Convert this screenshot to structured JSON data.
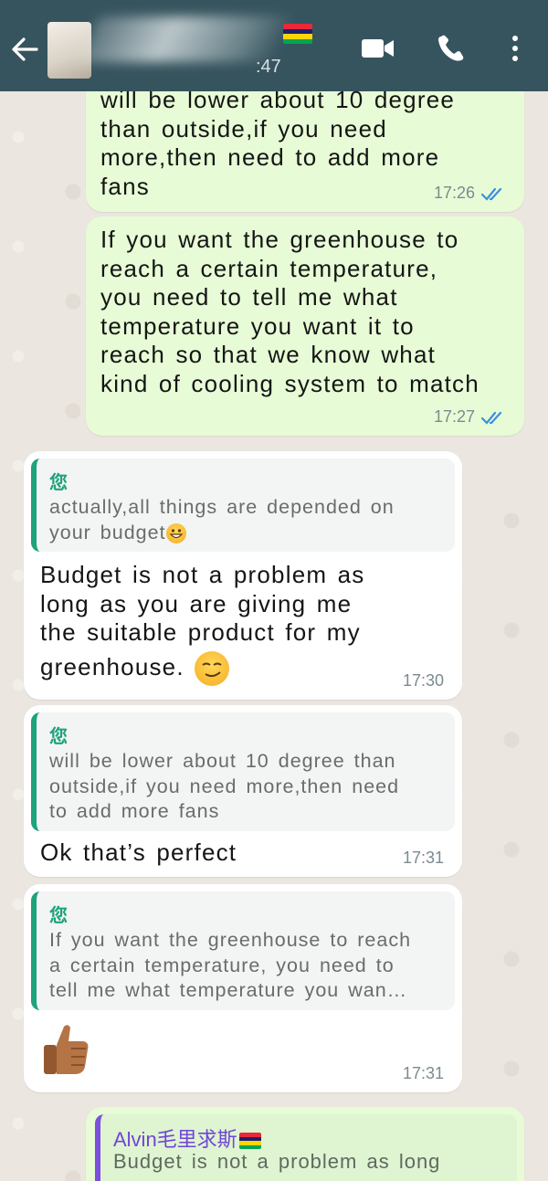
{
  "header": {
    "back_icon": "back-arrow-icon",
    "last_seen": ":47",
    "flag_colors": [
      "#EA2839",
      "#1A206D",
      "#FFD500",
      "#00A551"
    ],
    "icons": [
      "video-call-icon",
      "voice-call-icon",
      "more-options-icon"
    ],
    "header_color": "#36545E"
  },
  "messages": [
    {
      "type": "outgoing",
      "lines": [
        "will be lower about 10 degree",
        "than outside,if you need",
        "more,then need to add more",
        "fans"
      ],
      "time": "17:26",
      "status": "read"
    },
    {
      "type": "outgoing",
      "lines": [
        "If you want the greenhouse to",
        "reach a certain temperature,",
        "you need to tell me what",
        "temperature you want it to",
        "reach so that we know what",
        "kind of cooling system to match"
      ],
      "time": "17:27",
      "status": "read"
    },
    {
      "type": "incoming",
      "quote_author": "您",
      "quote_lines": [
        "actually,all things are depended on",
        "your budget"
      ],
      "quote_emoji": "grinning-face-emoji",
      "lines": [
        "Budget is not a problem as",
        "long as you are giving me",
        "the suitable product for my",
        "greenhouse."
      ],
      "emoji": "smirking-face-emoji",
      "time": "17:30"
    },
    {
      "type": "incoming",
      "quote_author": "您",
      "quote_lines": [
        "will be lower about 10 degree than",
        "outside,if you need more,then need",
        "to add more fans"
      ],
      "lines": [
        "Ok that’s perfect"
      ],
      "time": "17:31"
    },
    {
      "type": "incoming",
      "quote_author": "您",
      "quote_lines": [
        "If you want the greenhouse to reach",
        "a certain temperature, you need to",
        "tell me what temperature you wan…"
      ],
      "emoji": "thumbs-up-emoji",
      "time": "17:31"
    },
    {
      "type": "outgoing",
      "quote_author": "Alvin毛里求斯",
      "quote_flag": true,
      "quote_lines": [
        "Budget is not a problem as long"
      ]
    }
  ],
  "colors": {
    "outgoing_bubble": "#E7FCD6",
    "incoming_bubble": "#FFFFFF",
    "quote_bar_green": "#1EA37B",
    "quote_bar_purple": "#7B4FE0",
    "read_ticks": "#3B8FE0"
  }
}
